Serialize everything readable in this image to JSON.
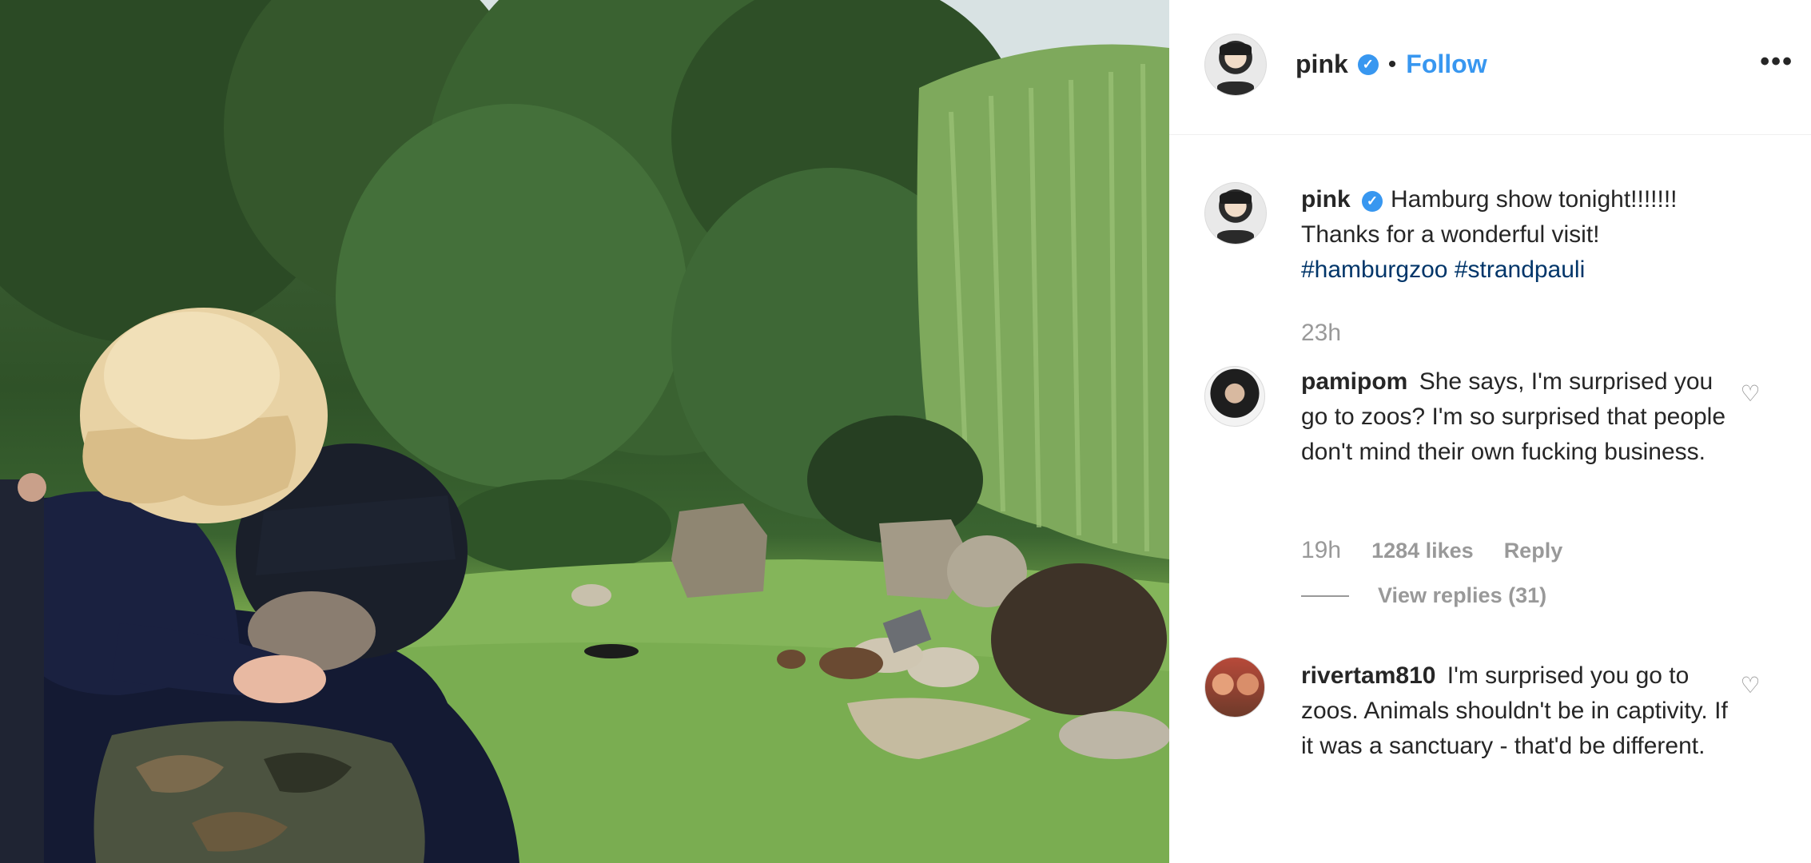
{
  "header": {
    "username": "pink",
    "separator": "•",
    "follow_label": "Follow",
    "more_label": "•••"
  },
  "caption": {
    "username": "pink",
    "text": "Hamburg show tonight!!!!!!! Thanks for a wonderful visit!",
    "hashtags": [
      "#hamburgzoo",
      "#strandpauli"
    ],
    "time": "23h"
  },
  "comments": [
    {
      "username": "pamipom",
      "text": "She says, I'm surprised you go to zoos? I'm so surprised that people don't mind their own fucking business.",
      "time": "19h",
      "likes": "1284 likes",
      "reply_label": "Reply",
      "view_replies": "View replies (31)"
    },
    {
      "username": "rivertam810",
      "text": "I'm surprised you go to zoos. Animals shouldn't be in captivity. If it was a sanctuary - that'd be different."
    }
  ],
  "icons": {
    "verified": "verified-badge-icon",
    "heart": "heart-icon",
    "more": "more-options-icon"
  },
  "colors": {
    "link_blue": "#3897f0",
    "hashtag": "#003569",
    "muted": "#999999"
  }
}
